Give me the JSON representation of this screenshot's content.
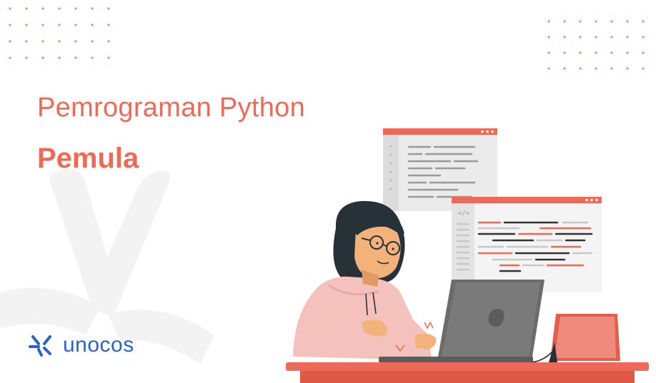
{
  "banner": {
    "title": "Pemrograman Python",
    "subtitle": "Pemula",
    "brand": "unocos",
    "code_tag": "</>"
  },
  "colors": {
    "accent": "#ee6a58",
    "dots": "#f08a7c",
    "brand": "#2a62c9",
    "watermark": "#f3f3f3"
  },
  "icons": {
    "logo": "unocos-logo-icon",
    "laptop": "laptop-icon",
    "tablet": "tablet-icon",
    "code_window": "code-window-icon"
  }
}
